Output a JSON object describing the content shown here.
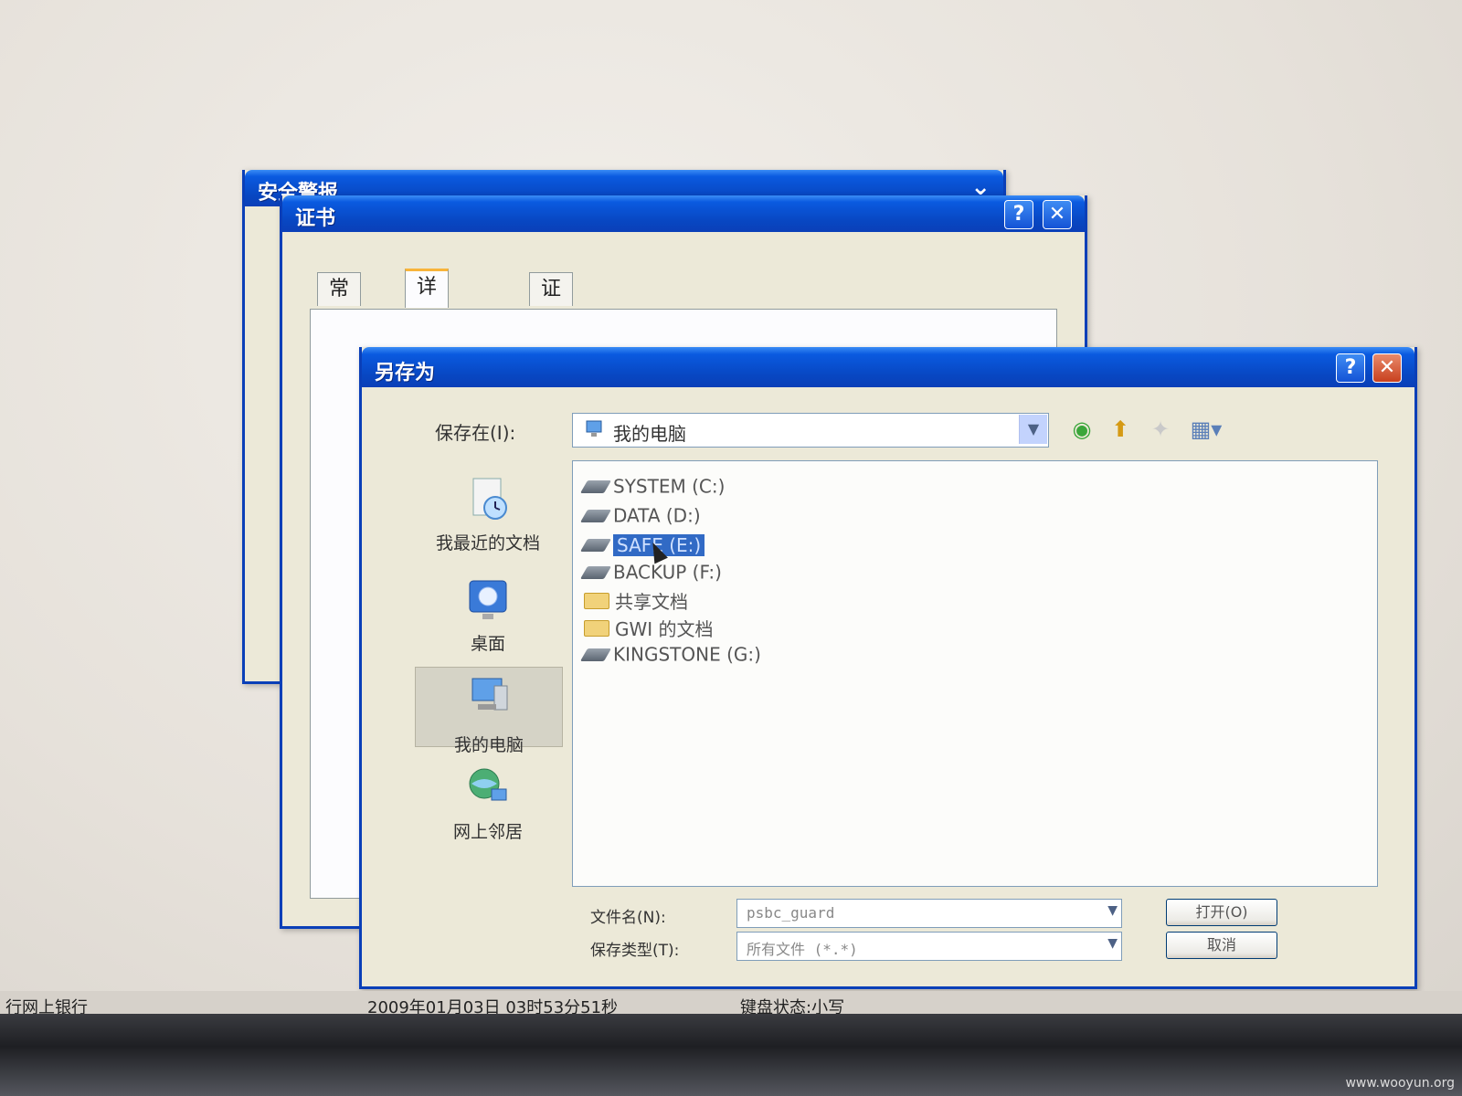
{
  "security_window": {
    "title": "安全警报"
  },
  "cert_window": {
    "title": "证书",
    "help_label": "?",
    "close_label": "✕",
    "tabs": [
      {
        "label": "常规"
      },
      {
        "label": "详细信息"
      },
      {
        "label": "证书路径"
      }
    ],
    "active_tab": "详细信息"
  },
  "saveas_window": {
    "title": "另存为",
    "help_label": "?",
    "close_label": "✕",
    "save_in_label": "保存在(I):",
    "save_in_value": "我的电脑",
    "places": [
      {
        "label": "我最近的文档",
        "icon": "recent-documents-icon"
      },
      {
        "label": "桌面",
        "icon": "desktop-icon"
      },
      {
        "label": "我的电脑",
        "icon": "my-computer-icon"
      },
      {
        "label": "网上邻居",
        "icon": "network-places-icon"
      }
    ],
    "files": [
      {
        "label": "SYSTEM (C:)",
        "type": "drive"
      },
      {
        "label": "DATA (D:)",
        "type": "drive"
      },
      {
        "label": "SAFE (E:)",
        "type": "drive",
        "selected": true
      },
      {
        "label": "BACKUP (F:)",
        "type": "drive"
      },
      {
        "label": "共享文档",
        "type": "folder"
      },
      {
        "label": "GWI 的文档",
        "type": "folder"
      },
      {
        "label": "KINGSTONE (G:)",
        "type": "drive"
      }
    ],
    "filename_label": "文件名(N):",
    "filename_value": "psbc_guard",
    "filetype_label": "保存类型(T):",
    "filetype_value": "所有文件 (*.*)",
    "open_button": "打开(O)",
    "cancel_button": "取消"
  },
  "status_bar": {
    "left": "行网上银行",
    "datetime": "2009年01月03日  03时53分51秒",
    "keyboard": "键盘状态:小写"
  },
  "watermark": "www.wooyun.org",
  "colors": {
    "titlebar": "#0a3fb8",
    "selection": "#316ac5",
    "window_bg": "#ece9d8"
  }
}
